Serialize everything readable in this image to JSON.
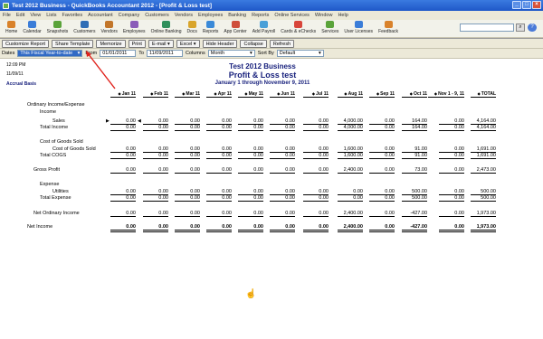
{
  "window": {
    "title": "Test 2012 Business  -  QuickBooks Accountant 2012 - [Profit & Loss test]",
    "controls": [
      "_",
      "□",
      "×"
    ]
  },
  "menu": [
    "File",
    "Edit",
    "View",
    "Lists",
    "Favorites",
    "Accountant",
    "Company",
    "Customers",
    "Vendors",
    "Employees",
    "Banking",
    "Reports",
    "Online Services",
    "Window",
    "Help"
  ],
  "iconbar": {
    "items": [
      {
        "label": "Home",
        "icon": "home-icon",
        "color": "#d9822b"
      },
      {
        "label": "Calendar",
        "icon": "calendar-icon",
        "color": "#3b7dd8"
      },
      {
        "label": "Snapshots",
        "icon": "snapshots-icon",
        "color": "#5aa33a"
      },
      {
        "label": "Customers",
        "icon": "customers-icon",
        "color": "#2f6db5"
      },
      {
        "label": "Vendors",
        "icon": "vendors-icon",
        "color": "#c2762a"
      },
      {
        "label": "Employees",
        "icon": "employees-icon",
        "color": "#8a5bb8"
      },
      {
        "label": "Online Banking",
        "icon": "online-banking-icon",
        "color": "#2f8f5b"
      },
      {
        "label": "Docs",
        "icon": "docs-icon",
        "color": "#d9a52b"
      },
      {
        "label": "Reports",
        "icon": "reports-icon",
        "color": "#3b8ad8"
      },
      {
        "label": "App Center",
        "icon": "app-center-icon",
        "color": "#cf4d3a"
      },
      {
        "label": "Add Payroll",
        "icon": "add-payroll-icon",
        "color": "#4aa0d8"
      },
      {
        "label": "Cards & eChecks",
        "icon": "cards-echecks-icon",
        "color": "#d8453a"
      },
      {
        "label": "Services",
        "icon": "services-icon",
        "color": "#5aa33a"
      },
      {
        "label": "User Licenses",
        "icon": "user-licenses-icon",
        "color": "#3b7dd8"
      },
      {
        "label": "Feedback",
        "icon": "feedback-icon",
        "color": "#d9822b"
      }
    ],
    "search_value": ""
  },
  "report_toolbar": {
    "buttons": [
      "Customize Report",
      "Share Template",
      "Memorize",
      "Print",
      "E-mail",
      "Excel",
      "Hide Header",
      "Collapse",
      "Refresh"
    ],
    "dates_label": "Dates",
    "dates_value": "This Fiscal Year-to-date",
    "from_label": "From",
    "from_value": "01/01/2011",
    "to_label": "To",
    "to_value": "11/09/2011",
    "columns_label": "Columns",
    "columns_value": "Month",
    "sortby_label": "Sort By",
    "sortby_value": "Default"
  },
  "report": {
    "time": "12:09 PM",
    "date": "11/09/11",
    "basis": "Accrual Basis",
    "company": "Test 2012 Business",
    "title": "Profit & Loss test",
    "subtitle": "January 1 through November 9, 2011",
    "columns": [
      "Jan 11",
      "Feb 11",
      "Mar 11",
      "Apr 11",
      "May 11",
      "Jun 11",
      "Jul 11",
      "Aug 11",
      "Sep 11",
      "Oct 11",
      "Nov 1 - 9, 11",
      "TOTAL"
    ],
    "rows": [
      {
        "label": "Ordinary Income/Expense",
        "indent": 0,
        "values": null
      },
      {
        "label": "Income",
        "indent": 1,
        "values": null
      },
      {
        "label": "Sales",
        "indent": 2,
        "values": [
          "0.00",
          "0.00",
          "0.00",
          "0.00",
          "0.00",
          "0.00",
          "0.00",
          "4,000.00",
          "0.00",
          "164.00",
          "0.00",
          "4,164.00"
        ]
      },
      {
        "label": "Total Income",
        "indent": 1,
        "values": [
          "0.00",
          "0.00",
          "0.00",
          "0.00",
          "0.00",
          "0.00",
          "0.00",
          "4,000.00",
          "0.00",
          "164.00",
          "0.00",
          "4,164.00"
        ]
      },
      {
        "label": "Cost of Goods Sold",
        "indent": 1,
        "values": null
      },
      {
        "label": "Cost of Goods Sold",
        "indent": 2,
        "values": [
          "0.00",
          "0.00",
          "0.00",
          "0.00",
          "0.00",
          "0.00",
          "0.00",
          "1,600.00",
          "0.00",
          "91.00",
          "0.00",
          "1,691.00"
        ]
      },
      {
        "label": "Total COGS",
        "indent": 1,
        "values": [
          "0.00",
          "0.00",
          "0.00",
          "0.00",
          "0.00",
          "0.00",
          "0.00",
          "1,600.00",
          "0.00",
          "91.00",
          "0.00",
          "1,691.00"
        ]
      },
      {
        "label": "Gross Profit",
        "indent": 0.5,
        "values": [
          "0.00",
          "0.00",
          "0.00",
          "0.00",
          "0.00",
          "0.00",
          "0.00",
          "2,400.00",
          "0.00",
          "73.00",
          "0.00",
          "2,473.00"
        ]
      },
      {
        "label": "Expense",
        "indent": 1,
        "values": null
      },
      {
        "label": "Utilities",
        "indent": 2,
        "values": [
          "0.00",
          "0.00",
          "0.00",
          "0.00",
          "0.00",
          "0.00",
          "0.00",
          "0.00",
          "0.00",
          "500.00",
          "0.00",
          "500.00"
        ]
      },
      {
        "label": "Total Expense",
        "indent": 1,
        "values": [
          "0.00",
          "0.00",
          "0.00",
          "0.00",
          "0.00",
          "0.00",
          "0.00",
          "0.00",
          "0.00",
          "500.00",
          "0.00",
          "500.00"
        ]
      },
      {
        "label": "Net Ordinary Income",
        "indent": 0.5,
        "values": [
          "0.00",
          "0.00",
          "0.00",
          "0.00",
          "0.00",
          "0.00",
          "0.00",
          "2,400.00",
          "0.00",
          "-427.00",
          "0.00",
          "1,973.00"
        ]
      },
      {
        "label": "Net Income",
        "indent": 0,
        "values": [
          "0.00",
          "0.00",
          "0.00",
          "0.00",
          "0.00",
          "0.00",
          "0.00",
          "2,400.00",
          "0.00",
          "-427.00",
          "0.00",
          "1,973.00"
        ]
      }
    ]
  },
  "colors": {
    "title_blue": "#1a237e",
    "annotation_red": "#e0201a",
    "selection_blue": "#316ac5"
  }
}
